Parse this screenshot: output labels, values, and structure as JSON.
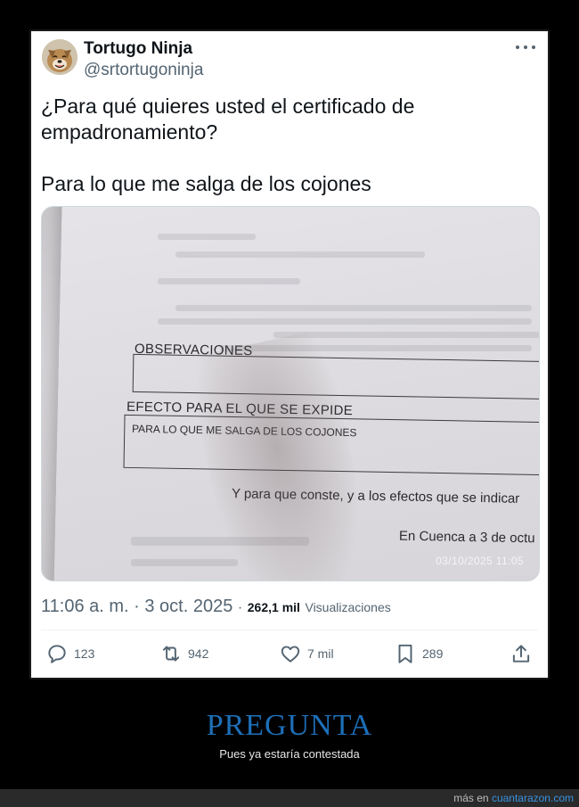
{
  "tweet": {
    "author": {
      "display_name": "Tortugo Ninja",
      "handle": "@srtortugoninja",
      "avatar_icon": "dog-avatar"
    },
    "more_icon": "ellipsis-icon",
    "text_lines": [
      "¿Para qué quieres usted el certificado de",
      "empadronamiento?",
      "Para lo que me salga de los cojones"
    ],
    "photo": {
      "label_observaciones": "OBSERVACIONES",
      "label_efecto": "EFECTO PARA EL QUE SE EXPIDE",
      "efecto_value": "PARA LO QUE ME SALGA DE LOS COJONES",
      "line_conste": "Y para que conste, y a los efectos que se indicar",
      "line_cuenca": "En Cuenca a 3 de octu",
      "timestamp_stamp": "03/10/2025 11:05"
    },
    "meta": {
      "time_date": "11:06 a. m. · 3 oct. 2025",
      "separator": "·",
      "views_count": "262,1 mil",
      "views_label": "Visualizaciones"
    },
    "actions": {
      "replies": "123",
      "retweets": "942",
      "likes": "7 mil",
      "bookmarks": "289"
    }
  },
  "caption": {
    "title": "PREGUNTA",
    "subtitle": "Pues ya estaría contestada"
  },
  "footer": {
    "prefix": "más en",
    "site": "cuantarazon.com"
  },
  "colors": {
    "background": "#000000",
    "caption_title": "#1d6fb8",
    "link": "#3a92e0",
    "secondary_text": "#536471"
  }
}
